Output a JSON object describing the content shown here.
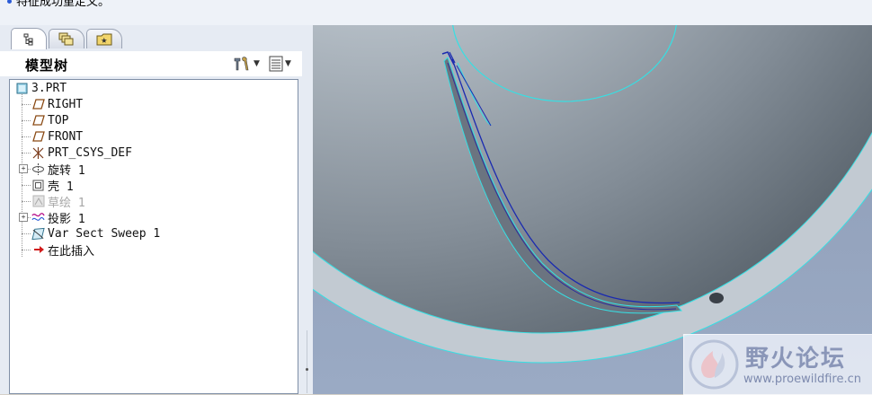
{
  "message_bar": {
    "text": "特征成功重定义。"
  },
  "tabs": [
    {
      "icon": "model-tree-tab-icon"
    },
    {
      "icon": "layers-tab-icon"
    },
    {
      "icon": "favorites-folder-tab-icon"
    }
  ],
  "tree_header": {
    "title": "模型树",
    "settings_icon": "tools-icon",
    "show_icon": "list-view-icon"
  },
  "tree": {
    "items": [
      {
        "label": "3.PRT",
        "icon": "part-icon"
      },
      {
        "label": "RIGHT",
        "icon": "datum-plane-icon"
      },
      {
        "label": "TOP",
        "icon": "datum-plane-icon"
      },
      {
        "label": "FRONT",
        "icon": "datum-plane-icon"
      },
      {
        "label": "PRT_CSYS_DEF",
        "icon": "coordinate-system-icon"
      },
      {
        "label": "旋转 1",
        "icon": "revolve-icon"
      },
      {
        "label": "壳 1",
        "icon": "shell-icon"
      },
      {
        "label": "草绘 1",
        "icon": "sketch-icon"
      },
      {
        "label": "投影 1",
        "icon": "projection-icon"
      },
      {
        "label": "Var Sect Sweep 1",
        "icon": "var-sect-sweep-icon"
      },
      {
        "label": "在此插入",
        "icon": "insert-here-arrow-icon"
      }
    ]
  },
  "watermark": {
    "title": "野火论坛",
    "url": "www.proewildfire.cn"
  },
  "colors": {
    "sphere_light": "#e9eef2",
    "sphere_dark": "#55606b",
    "edge_cyan": "#35e0e4",
    "background_blue": "#93a3bf",
    "curve_blue": "#1a2ab0"
  }
}
